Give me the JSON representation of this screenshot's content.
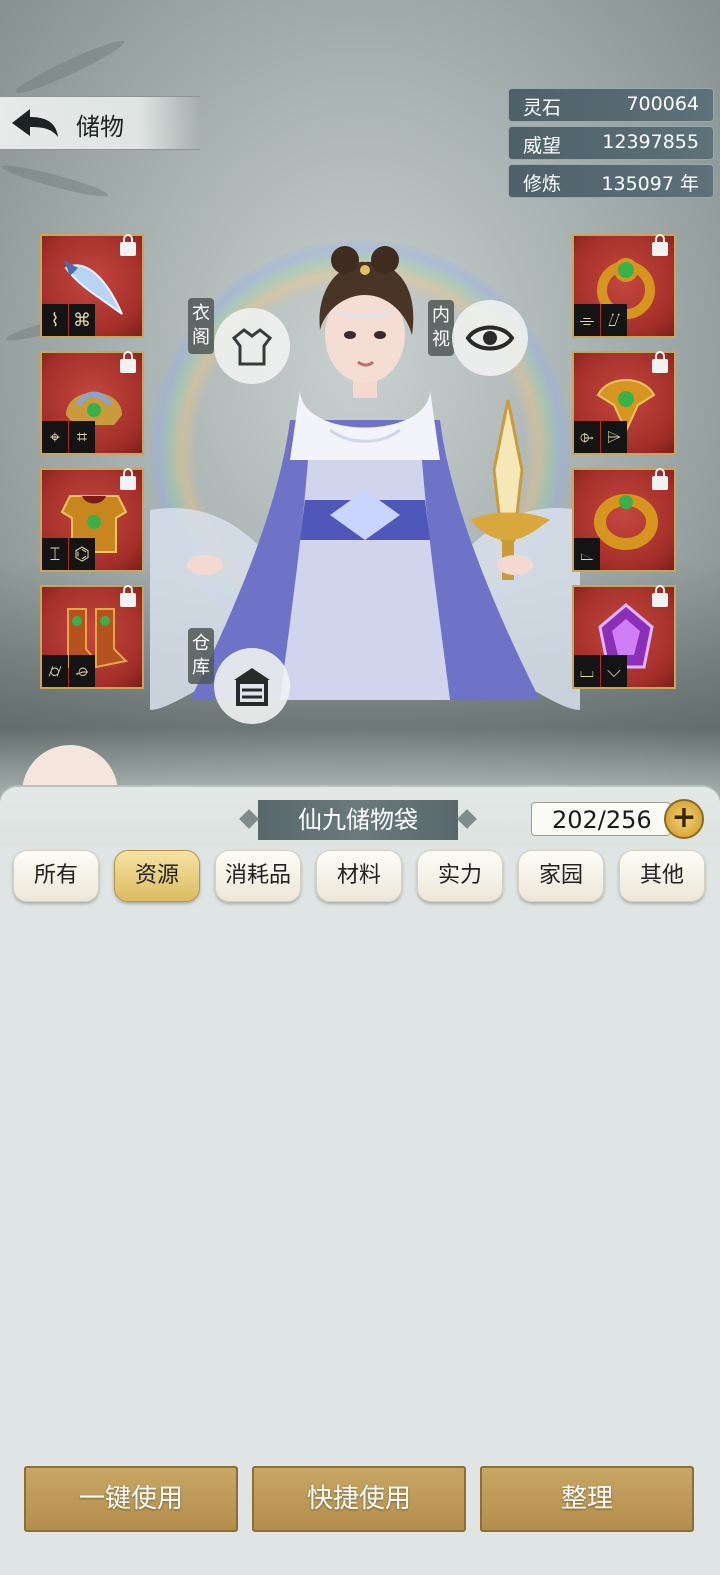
{
  "header": {
    "title": "储物"
  },
  "resources": [
    {
      "label": "灵石",
      "value": "700064"
    },
    {
      "label": "威望",
      "value": "12397855"
    },
    {
      "label": "修炼",
      "value": "135097 年"
    }
  ],
  "character_buttons": {
    "wardrobe": "衣阁",
    "inner_view": "内视",
    "warehouse": "仓库"
  },
  "bag": {
    "title": "仙九储物袋",
    "capacity": "202/256"
  },
  "tabs": [
    "所有",
    "资源",
    "消耗品",
    "材料",
    "实力",
    "家园",
    "其他"
  ],
  "active_tab": "资源",
  "actions": {
    "use_all": "一键使用",
    "quick_use": "快捷使用",
    "sort": "整理"
  }
}
